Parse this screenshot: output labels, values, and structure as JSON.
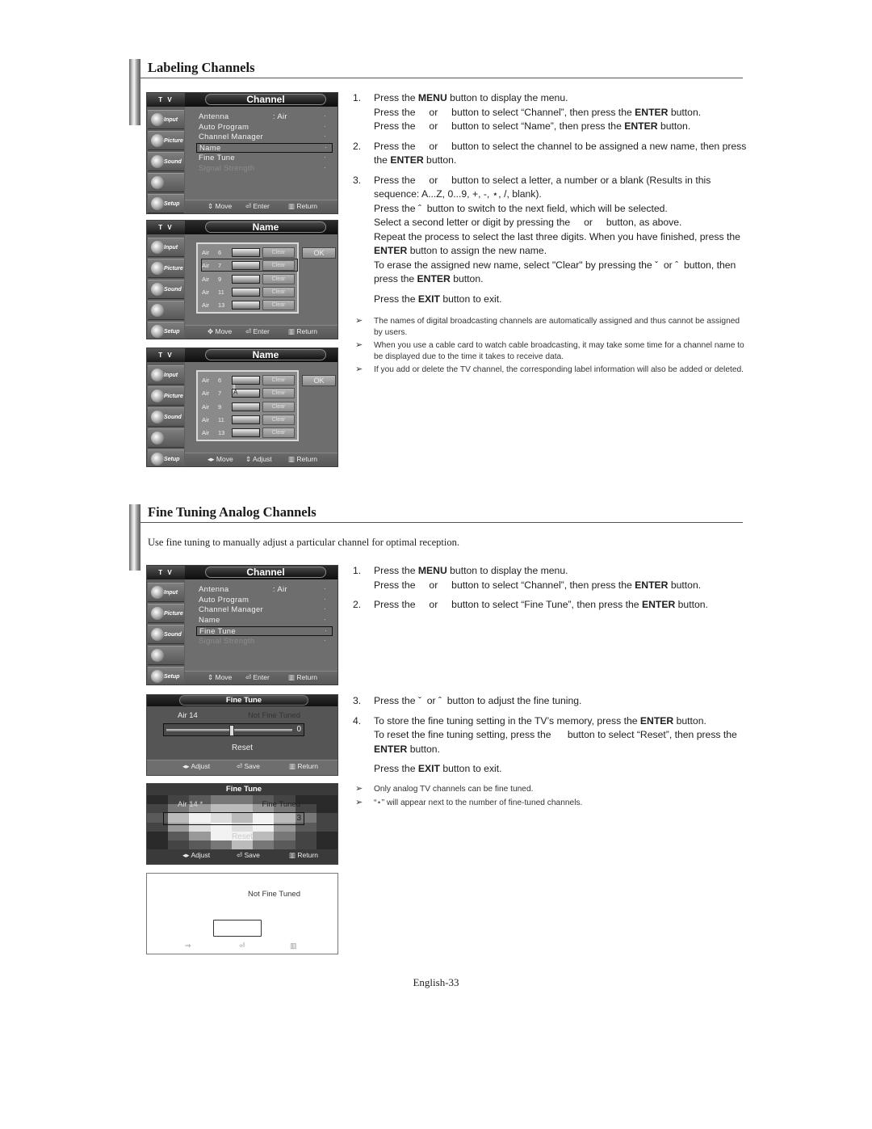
{
  "sections": {
    "labeling": {
      "title": "Labeling Channels"
    },
    "fine_tuning": {
      "title": "Fine Tuning Analog Channels",
      "intro": "Use fine tuning to manually adjust a particular channel for optimal reception."
    }
  },
  "osd_common": {
    "tv_label": "T V",
    "sidebar": [
      {
        "icon": "input-icon",
        "label": "Input"
      },
      {
        "icon": "picture-icon",
        "label": "Picture"
      },
      {
        "icon": "sound-icon",
        "label": "Sound"
      },
      {
        "icon": "channel-icon",
        "label": ""
      },
      {
        "icon": "setup-icon",
        "label": "Setup"
      }
    ]
  },
  "channel_menu_1": {
    "title": "Channel",
    "items": [
      {
        "label": "Antenna",
        "value": ": Air"
      },
      {
        "label": "Auto Program",
        "value": ""
      },
      {
        "label": "Channel Manager",
        "value": ""
      },
      {
        "label": "Name",
        "value": "",
        "selected": true
      },
      {
        "label": "Fine Tune",
        "value": ""
      },
      {
        "label": "Signal Strength",
        "value": "",
        "disabled": true
      }
    ],
    "footer": {
      "move": "Move",
      "enter": "Enter",
      "return": "Return"
    }
  },
  "name_menu_1": {
    "title": "Name",
    "rows": [
      {
        "ant": "Air",
        "ch": "6",
        "name": "",
        "clear": "Clear"
      },
      {
        "ant": "Air",
        "ch": "7",
        "name": "",
        "clear": "Clear",
        "selected": true
      },
      {
        "ant": "Air",
        "ch": "9",
        "name": "",
        "clear": "Clear"
      },
      {
        "ant": "Air",
        "ch": "11",
        "name": "",
        "clear": "Clear"
      },
      {
        "ant": "Air",
        "ch": "13",
        "name": "",
        "clear": "Clear"
      }
    ],
    "ok": "OK",
    "footer": {
      "move": "Move",
      "enter": "Enter",
      "return": "Return"
    }
  },
  "name_menu_2": {
    "title": "Name",
    "rows": [
      {
        "ant": "Air",
        "ch": "6",
        "name": "",
        "clear": "Clear"
      },
      {
        "ant": "Air",
        "ch": "7",
        "name": "A",
        "clear": "Clear",
        "editing": true
      },
      {
        "ant": "Air",
        "ch": "9",
        "name": "",
        "clear": "Clear"
      },
      {
        "ant": "Air",
        "ch": "11",
        "name": "",
        "clear": "Clear"
      },
      {
        "ant": "Air",
        "ch": "13",
        "name": "",
        "clear": "Clear"
      }
    ],
    "ok": "OK",
    "footer": {
      "move": "Move",
      "adjust": "Adjust",
      "return": "Return"
    }
  },
  "channel_menu_2": {
    "title": "Channel",
    "items": [
      {
        "label": "Antenna",
        "value": ": Air"
      },
      {
        "label": "Auto Program",
        "value": ""
      },
      {
        "label": "Channel Manager",
        "value": ""
      },
      {
        "label": "Name",
        "value": ""
      },
      {
        "label": "Fine Tune",
        "value": "",
        "selected": true
      },
      {
        "label": "Signal Strength",
        "value": "",
        "disabled": true
      }
    ],
    "footer": {
      "move": "Move",
      "enter": "Enter",
      "return": "Return"
    }
  },
  "fine_tune_1": {
    "title": "Fine Tune",
    "channel": "Air  14",
    "status": "Not Fine Tuned",
    "value": "0",
    "slider_fraction": 0.5,
    "reset": "Reset",
    "footer": {
      "adjust": "Adjust",
      "save": "Save",
      "return": "Return"
    }
  },
  "fine_tune_2": {
    "title": "Fine Tune",
    "channel": "Air  14 *",
    "status": "Fine Tuned",
    "value": "3",
    "reset": "Reset",
    "footer": {
      "adjust": "Adjust",
      "save": "Save",
      "return": "Return"
    }
  },
  "fine_tune_3": {
    "status": "Not Fine Tuned"
  },
  "labeling_steps": [
    {
      "num": "1.",
      "lines": [
        "Press the <b>MENU</b> button to display the menu.",
        "Press the &nbsp;&nbsp;&nbsp;&nbsp;or &nbsp;&nbsp;&nbsp;&nbsp;button to select “Channel”, then press the <b>ENTER</b> button.",
        "Press the &nbsp;&nbsp;&nbsp;&nbsp;or &nbsp;&nbsp;&nbsp;&nbsp;button to select “Name”, then press the <b>ENTER</b> button."
      ]
    },
    {
      "num": "2.",
      "lines": [
        "Press the &nbsp;&nbsp;&nbsp;&nbsp;or &nbsp;&nbsp;&nbsp;&nbsp;button to select the channel to be assigned a new name, then press the <b>ENTER</b> button."
      ]
    },
    {
      "num": "3.",
      "lines": [
        "Press the &nbsp;&nbsp;&nbsp;&nbsp;or &nbsp;&nbsp;&nbsp;&nbsp;button to select a letter, a number or a blank (Results in this sequence: A...Z, 0...9, +, -, ⋆, /, blank).",
        "Press the ˆ &nbsp;button to switch to the next field, which will be selected.",
        "Select a second letter or digit by pressing the &nbsp;&nbsp;&nbsp;&nbsp;or &nbsp;&nbsp;&nbsp;&nbsp;button, as above.",
        "Repeat the process to select the last three digits. When you have finished, press the <b>ENTER</b> button to assign the new name.",
        "To erase the assigned new name, select \"Clear\" by pressing the ˇ &nbsp;or ˆ &nbsp;button, then press the <b>ENTER</b> button."
      ]
    },
    {
      "num": "",
      "lines": [
        "Press the <b>EXIT</b> button to exit."
      ]
    }
  ],
  "labeling_notes": [
    "The names of digital broadcasting channels are automatically assigned and thus cannot be assigned by users.",
    "When you use a cable card to watch cable broadcasting, it may take some time for a channel name to be displayed due to the time it takes to receive data.",
    "If you add or delete the TV channel, the corresponding label information will also be added or deleted."
  ],
  "fine_steps_a": [
    {
      "num": "1.",
      "lines": [
        "Press the <b>MENU</b> button to display the menu.",
        "Press the &nbsp;&nbsp;&nbsp;&nbsp;or &nbsp;&nbsp;&nbsp;&nbsp;button to select “Channel”, then press the <b>ENTER</b> button."
      ]
    },
    {
      "num": "2.",
      "lines": [
        "Press the &nbsp;&nbsp;&nbsp;&nbsp;or &nbsp;&nbsp;&nbsp;&nbsp;button to select “Fine Tune”, then press the <b>ENTER</b> button."
      ]
    }
  ],
  "fine_steps_b": [
    {
      "num": "3.",
      "lines": [
        "Press the ˇ &nbsp;or ˆ &nbsp;button to adjust the fine tuning."
      ]
    },
    {
      "num": "4.",
      "lines": [
        "To store the fine tuning setting in the TV’s memory, press the <b>ENTER</b> button.",
        "To reset the fine tuning setting, press the &nbsp;&nbsp;&nbsp;&nbsp;&nbsp;button to select “Reset”, then press the <b>ENTER</b> button."
      ]
    },
    {
      "num": "",
      "lines": [
        "Press the <b>EXIT</b> button to exit."
      ]
    }
  ],
  "fine_notes": [
    "Only analog TV channels can be fine tuned.",
    "“⋆” will appear next to the number of fine-tuned channels."
  ],
  "note_icon": "arrow-bullet-icon",
  "page_number": "English-33"
}
